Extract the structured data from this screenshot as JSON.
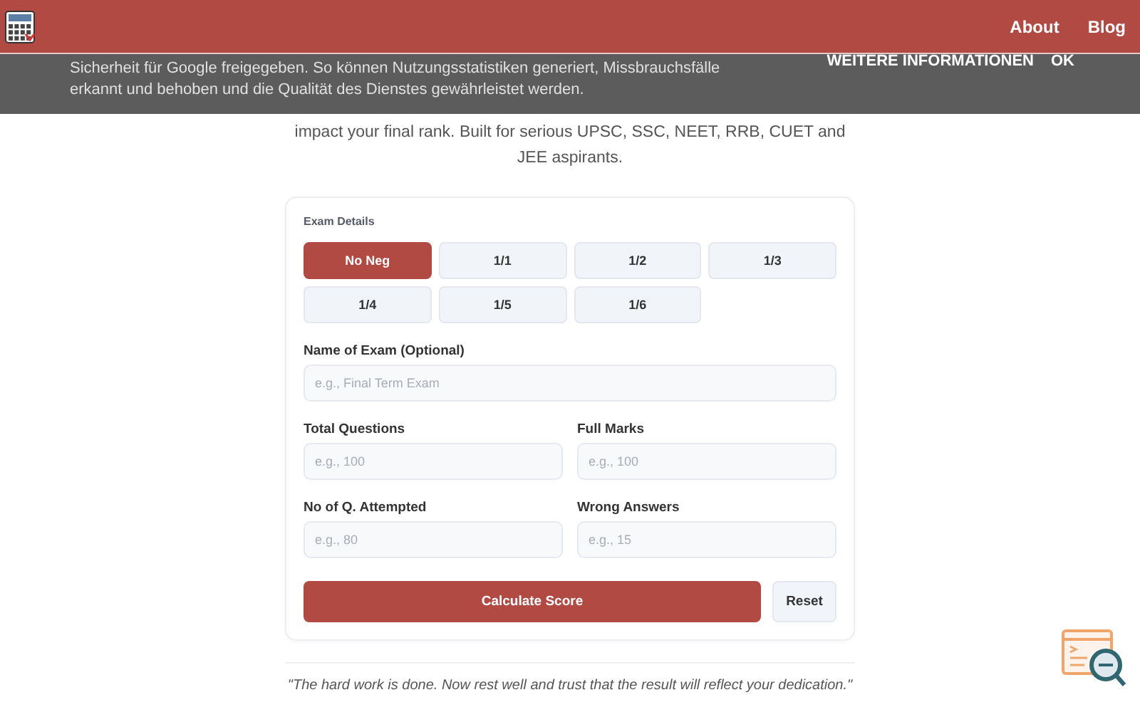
{
  "header": {
    "nav": [
      "About",
      "Blog"
    ]
  },
  "cookie_banner": {
    "text": "Sicherheit für Google freigegeben. So können Nutzungsstatistiken generiert, Missbrauchsfälle erkannt und behoben und die Qualität des Dienstes gewährleistet werden.",
    "buttons": [
      "WEITERE INFORMATIONEN",
      "OK"
    ]
  },
  "description": "impact your final rank. Built for serious UPSC, SSC, NEET, RRB, CUET and JEE aspirants.",
  "card": {
    "title": "Exam Details",
    "options": [
      {
        "label": "No Neg",
        "selected": true
      },
      {
        "label": "1/1",
        "selected": false
      },
      {
        "label": "1/2",
        "selected": false
      },
      {
        "label": "1/3",
        "selected": false
      },
      {
        "label": "1/4",
        "selected": false
      },
      {
        "label": "1/5",
        "selected": false
      },
      {
        "label": "1/6",
        "selected": false
      }
    ],
    "fields": [
      {
        "label": "Name of Exam (Optional)",
        "placeholder": "e.g., Final Term Exam",
        "wide": true
      },
      {
        "label": "Total Questions",
        "placeholder": "e.g., 100",
        "wide": false
      },
      {
        "label": "Full Marks",
        "placeholder": "e.g., 100",
        "wide": false
      },
      {
        "label": "No of Q. Attempted",
        "placeholder": "e.g., 80",
        "wide": false
      },
      {
        "label": "Wrong Answers",
        "placeholder": "e.g., 15",
        "wide": false
      }
    ],
    "primary_button": "Calculate Score",
    "secondary_button": "Reset"
  },
  "quote": "\"The hard work is done. Now rest well and trust that the result will reflect your dedication.\""
}
